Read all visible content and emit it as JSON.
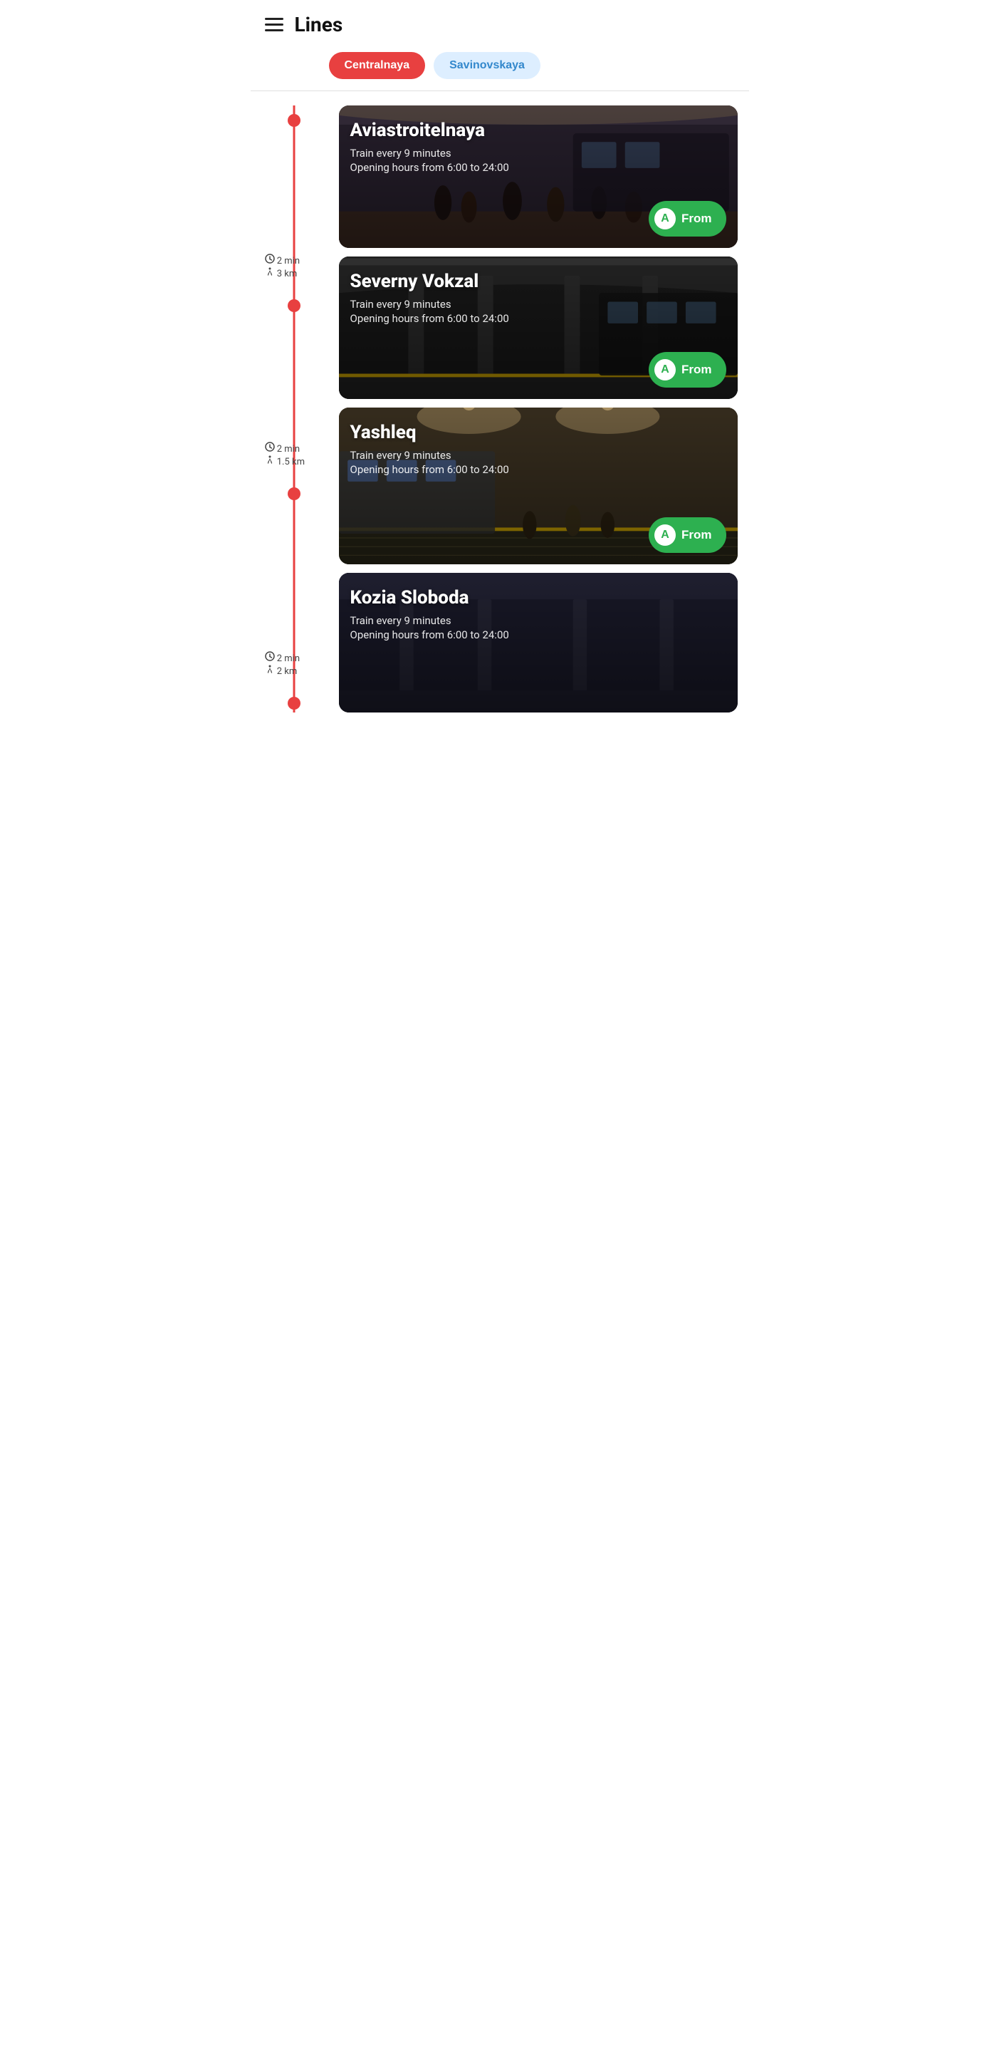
{
  "header": {
    "title": "Lines",
    "hamburger_label": "Menu"
  },
  "tabs": [
    {
      "id": "centralnaya",
      "label": "Centralnaya",
      "active": true
    },
    {
      "id": "savinovskaya",
      "label": "Savinovskaya",
      "active": false
    }
  ],
  "stations": [
    {
      "id": "aviastroitelnaya",
      "name": "Aviastroitelnaya",
      "train_info": "Train every 9 minutes",
      "hours_info": "Opening hours from 6:00 to 24:00",
      "from_label": "From",
      "from_icon": "A",
      "bg_class": "card-bg-aviastroitelnaya",
      "deco_class": "deco-aviastroitelnaya",
      "spacing": null
    },
    {
      "id": "severny-vokzal",
      "name": "Severny Vokzal",
      "train_info": "Train every 9 minutes",
      "hours_info": "Opening hours from 6:00 to 24:00",
      "from_label": "From",
      "from_icon": "A",
      "bg_class": "card-bg-severny",
      "deco_class": "deco-severny",
      "spacing": {
        "time": "2 min",
        "distance": "3 km"
      }
    },
    {
      "id": "yashleq",
      "name": "Yashleq",
      "train_info": "Train every 9 minutes",
      "hours_info": "Opening hours from 6:00 to 24:00",
      "from_label": "From",
      "from_icon": "A",
      "bg_class": "card-bg-yashleq",
      "deco_class": "deco-yashleq",
      "spacing": {
        "time": "2 min",
        "distance": "1.5 km"
      }
    },
    {
      "id": "kozia-sloboda",
      "name": "Kozia Sloboda",
      "train_info": "Train every 9 minutes",
      "hours_info": "Opening hours from 6:00 to 24:00",
      "from_label": "From",
      "from_icon": "A",
      "bg_class": "card-bg-kozia",
      "deco_class": "",
      "spacing": {
        "time": "2 min",
        "distance": "2 km"
      },
      "partial": true
    }
  ],
  "colors": {
    "active_tab_bg": "#e84040",
    "inactive_tab_bg": "#ddeeff",
    "inactive_tab_text": "#3388cc",
    "rail_color": "#e84040",
    "from_btn_color": "#2db050"
  }
}
